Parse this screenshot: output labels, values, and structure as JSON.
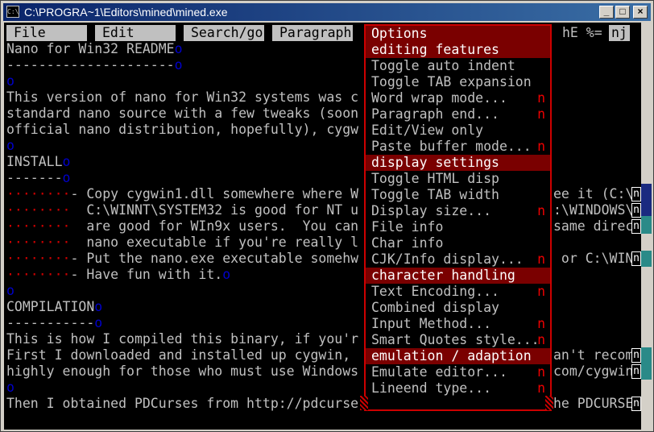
{
  "window": {
    "title": "C:\\PROGRA~1\\Editors\\mined\\mined.exe",
    "icon_label": "C:\\",
    "buttons": {
      "minimize": "_",
      "maximize": "□",
      "close": "×"
    }
  },
  "menubar": {
    "items": [
      "File",
      "Edit",
      "Search/go",
      "Paragraph"
    ],
    "status_left": "hE %=",
    "status_right": "nj"
  },
  "document": {
    "lines": [
      {
        "text": "Nano for Win32 README",
        "dot": "o"
      },
      {
        "text": "---------------------",
        "dot": "o"
      },
      {
        "text": "",
        "dot": "o"
      },
      {
        "text": "This version of nano for Win32 systems was c",
        "dot": ""
      },
      {
        "text": "standard nano source with a few tweaks (soon",
        "dot": ""
      },
      {
        "text": "official nano distribution, hopefully), cygw",
        "dot": ""
      },
      {
        "text": "",
        "dot": "o"
      },
      {
        "text": "INSTALL",
        "dot": "o"
      },
      {
        "text": "-------",
        "dot": "o"
      },
      {
        "dots": "········",
        "text": "- Copy cygwin1.dll somewhere where W",
        "dot": ""
      },
      {
        "dots": "········",
        "text": "  C:\\WINNT\\SYSTEM32 is good for NT u",
        "dot": ""
      },
      {
        "dots": "········",
        "text": "  are good for WIn9x users.  You can",
        "dot": ""
      },
      {
        "dots": "········",
        "text": "  nano executable if you're really l",
        "dot": ""
      },
      {
        "dots": "········",
        "text": "- Put the nano.exe executable somehw",
        "dot": ""
      },
      {
        "dots": "········",
        "text": "- Have fun with it.",
        "dot": "o"
      },
      {
        "text": "",
        "dot": "o"
      },
      {
        "text": "COMPILATION",
        "dot": "o"
      },
      {
        "text": "-----------",
        "dot": "o"
      },
      {
        "text": "This is how I compiled this binary, if you'r",
        "dot": ""
      },
      {
        "text": "First I downloaded and installed up cygwin,",
        "dot": ""
      },
      {
        "text": "highly enough for those who must use Windows",
        "dot": ""
      },
      {
        "text": "",
        "dot": "o"
      },
      {
        "text": "Then I obtained PDCurses from http://pdcurse",
        "dot": ""
      }
    ],
    "right_fragments": [
      {
        "row": 10,
        "text": "ee it (C:\\"
      },
      {
        "row": 11,
        "text": ":\\WINDOWS\\"
      },
      {
        "row": 12,
        "text": "same direc"
      },
      {
        "row": 14,
        "text": " or C:\\WIN"
      },
      {
        "row": 20,
        "text": "an't recom"
      },
      {
        "row": 21,
        "text": "com/cygwin"
      },
      {
        "row": 23,
        "text": "he PDCURSE"
      }
    ],
    "line_marker": "n"
  },
  "options_menu": {
    "title": "Options",
    "submenu_marker": "n",
    "sections": [
      {
        "header": "editing features",
        "items": [
          {
            "label": "Toggle auto indent",
            "sub": false
          },
          {
            "label": "Toggle TAB expansion",
            "sub": false
          },
          {
            "label": "Word wrap mode...",
            "sub": true
          },
          {
            "label": "Paragraph end...",
            "sub": true
          },
          {
            "label": "Edit/View only",
            "sub": false
          },
          {
            "label": "Paste buffer mode...",
            "sub": true
          }
        ]
      },
      {
        "header": "display settings",
        "items": [
          {
            "label": "Toggle HTML disp",
            "sub": false
          },
          {
            "label": "Toggle TAB width",
            "sub": false
          },
          {
            "label": "Display size...",
            "sub": true
          },
          {
            "label": "File info",
            "sub": false
          },
          {
            "label": "Char info",
            "sub": false
          },
          {
            "label": "CJK/Info display...",
            "sub": true
          }
        ]
      },
      {
        "header": "character handling",
        "items": [
          {
            "label": "Text Encoding...",
            "sub": true
          },
          {
            "label": "Combined display",
            "sub": false
          },
          {
            "label": "Input Method...",
            "sub": true
          },
          {
            "label": "Smart Quotes style...",
            "sub": true
          }
        ]
      },
      {
        "header": "emulation / adaption",
        "items": [
          {
            "label": "Emulate editor...",
            "sub": true
          },
          {
            "label": "Lineend type...",
            "sub": true
          }
        ]
      }
    ]
  },
  "colors": {
    "console_bg": "#000000",
    "text": "#c0c0c0",
    "menu_header": "#7a0000",
    "menu_border": "#cc0000",
    "dot": "#0000cc",
    "titlebar": "#0a246a"
  }
}
